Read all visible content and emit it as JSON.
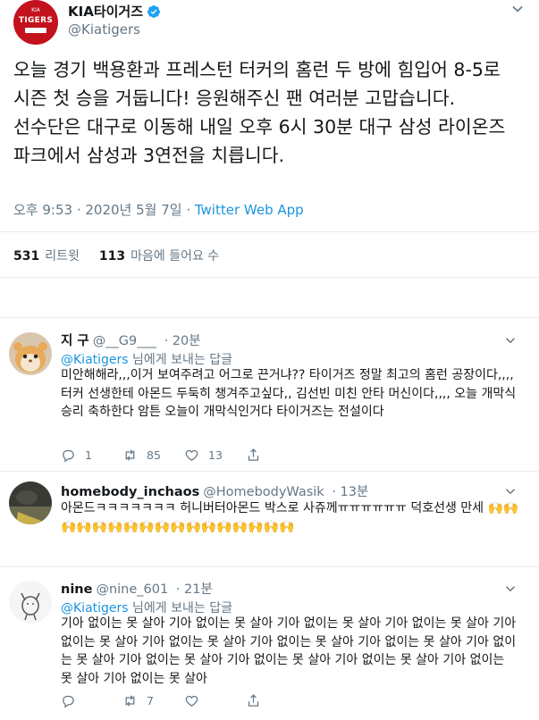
{
  "main_tweet": {
    "author_name": "KIA타이거즈",
    "author_handle": "@Kiatigers",
    "avatar_top_text": "KIA",
    "avatar_text": "TIGERS",
    "text": "오늘 경기 백용환과 프레스턴 터커의 홈런 두 방에 힘입어 8-5로 시즌 첫 승을 거둡니다! 응원해주신 팬 여러분 고맙습니다. 선수단은 대구로 이동해 내일 오후 6시 30분 대구 삼성 라이온즈 파크에서 삼성과 3연전을 치릅니다.",
    "timestamp": "오후 9:53 · 2020년 5월 7일 · ",
    "source": "Twitter Web App",
    "retweets_count": "531",
    "retweets_label": "리트윗",
    "likes_count": "113",
    "likes_label": "마음에 들어요 수"
  },
  "replies": [
    {
      "name": "지 구",
      "handle": "@__G9___",
      "time": "· 20분",
      "reply_to_mention": "@Kiatigers",
      "reply_to_suffix": " 님에게 보내는 답글",
      "text": "미안해해라,,,이거 보여주려고 어그로 끈거냐?? 타이거즈 정말 최고의 홈런 공장이다,,,, 터커 선생한테 아몬드 두둑히 챙겨주고싶다,, 김선빈 미친 안타 머신이다,,,, 오늘 개막식 승리 축하한다 암튼 오늘이 개막식인거다 타이거즈는 전설이다",
      "reply_count": "1",
      "retweet_count": "85",
      "like_count": "13"
    },
    {
      "name": "homebody_inchaos",
      "handle": "@HomebodyWasik",
      "time": "· 13분",
      "text": "아몬드ㅋㅋㅋㅋㅋㅋㅋ 허니버터아몬드 박스로 사쥬께ㅠㅠㅠㅠㅠㅠ 덕호선생 만세 🙌🙌🙌🙌🙌🙌🙌🙌🙌🙌🙌🙌🙌🙌🙌🙌🙌"
    },
    {
      "name": "nine",
      "handle": "@nine_601",
      "time": "· 21분",
      "reply_to_mention": "@Kiatigers",
      "reply_to_suffix": " 님에게 보내는 답글",
      "text": "기아 없이는 못 살아 기아 없이는 못 살아 기아 없이는 못 살아 기아 없이는 못 살아 기아 없이는 못 살아 기아 없이는 못 살아 기아 없이는 못 살아 기아 없이는 못 살아 기아 없이는 못 살아 기아 없이는 못 살아 기아 없이는 못 살아 기아 없이는 못 살아 기아 없이는 못 살아 기아 없이는 못 살아",
      "retweet_count": "7"
    }
  ],
  "icons": {
    "verified": "verified-badge-icon",
    "more": "chevron-down-icon",
    "reply": "reply-icon",
    "retweet": "retweet-icon",
    "like": "heart-icon",
    "share": "share-icon"
  },
  "colors": {
    "accent": "#1b95e0",
    "secondary_text": "#657786",
    "brand_red": "#c4111e",
    "divider": "#e6ecf0"
  }
}
